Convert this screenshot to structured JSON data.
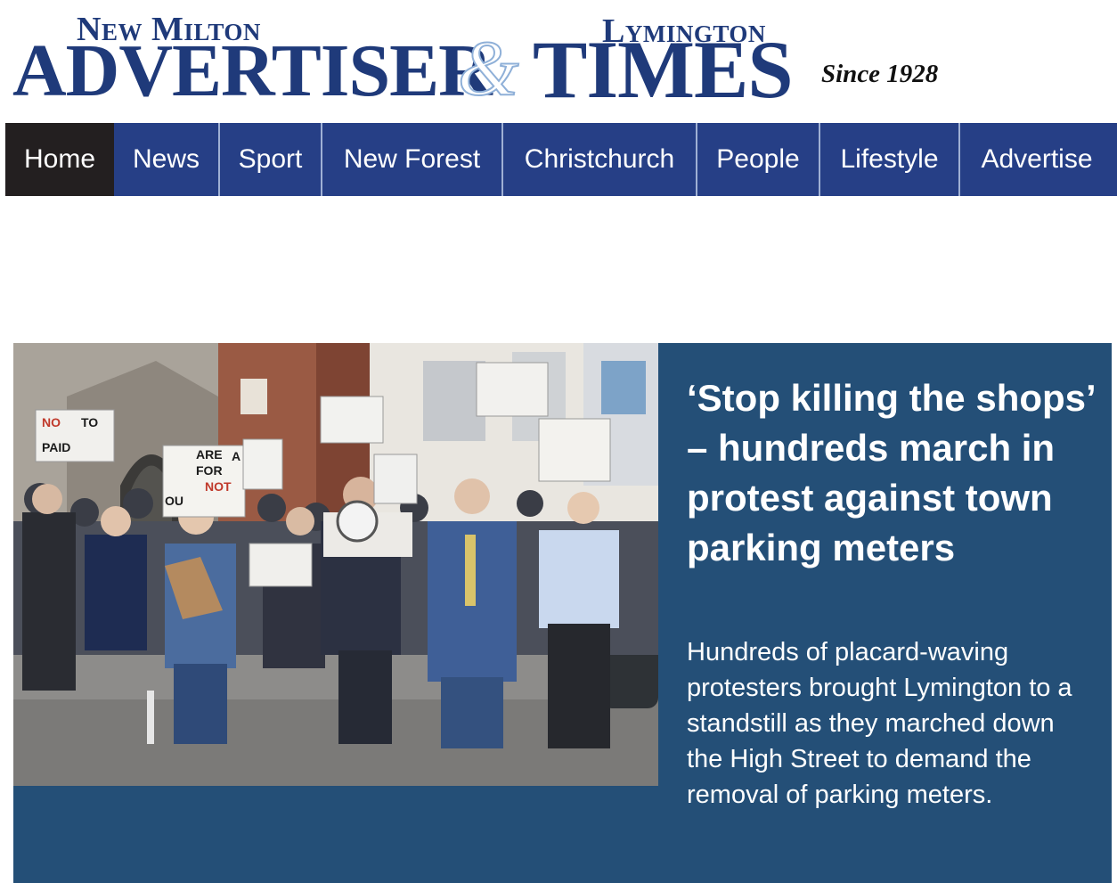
{
  "masthead": {
    "left_small": "New Milton",
    "left_big": "ADVERTISER",
    "ampersand": "&",
    "right_small": "Lymington",
    "right_big": "TIMES",
    "since": "Since 1928"
  },
  "nav": {
    "items": [
      "Home",
      "News",
      "Sport",
      "New Forest",
      "Christchurch",
      "People",
      "Lifestyle",
      "Advertise"
    ],
    "active": "Home"
  },
  "feature": {
    "headline": "‘Stop killing the shops’ – hundreds march in protest against town parking meters",
    "summary": "Hundreds of placard-waving protesters brought Lymington to a standstill as they marched down the High Street to demand the removal of parking meters.",
    "placards": [
      "NO",
      "TO",
      "PAID",
      "ARE",
      "FOR",
      "NOT",
      "OU",
      "A"
    ]
  },
  "colors": {
    "brand_blue": "#1f3a7a",
    "nav_blue": "#263f86",
    "nav_active": "#231f20",
    "feature_bg": "#244f77"
  }
}
